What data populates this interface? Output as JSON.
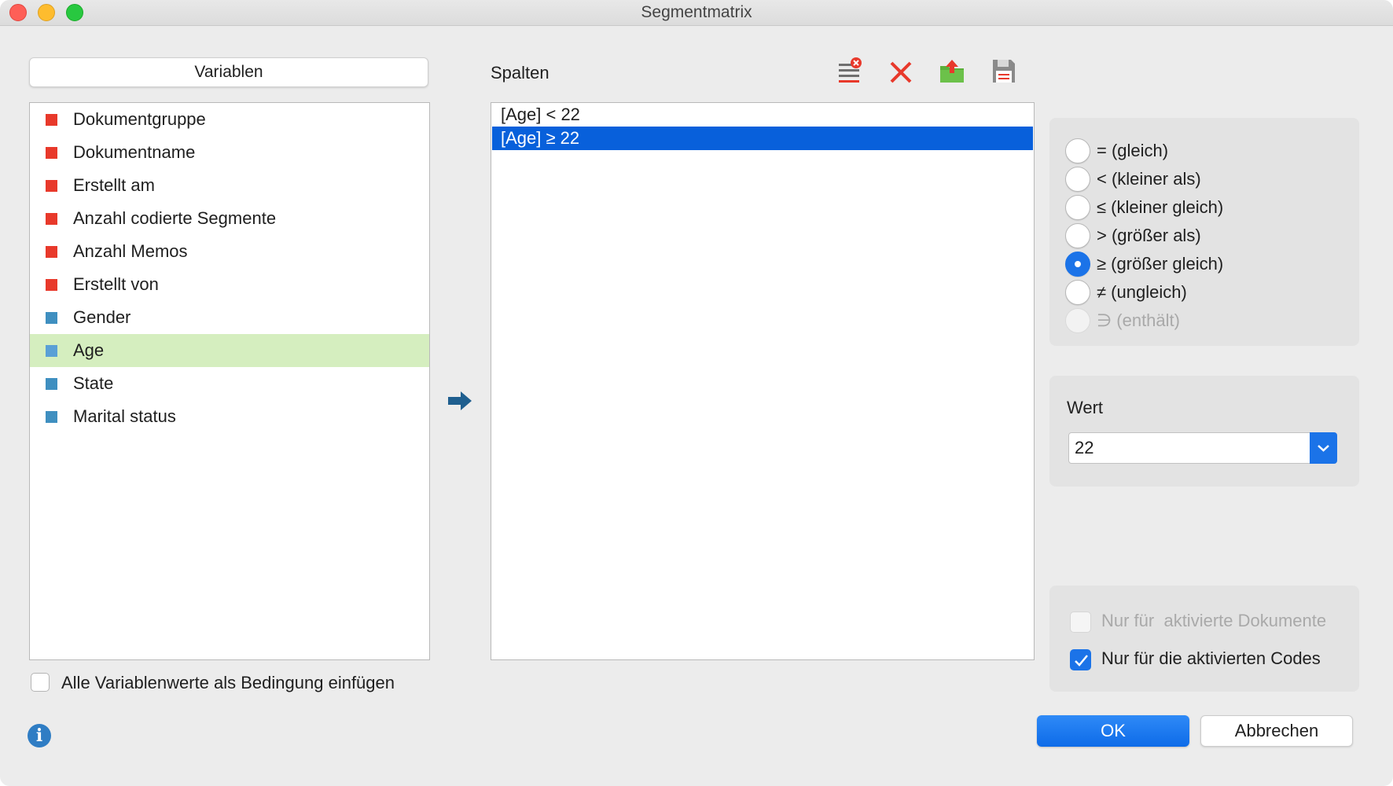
{
  "window": {
    "title": "Segmentmatrix"
  },
  "variables_panel": {
    "header_label": "Variablen",
    "items": [
      {
        "label": "Dokumentgruppe",
        "color": "#e8392b"
      },
      {
        "label": "Dokumentname",
        "color": "#e8392b"
      },
      {
        "label": "Erstellt am",
        "color": "#e8392b"
      },
      {
        "label": "Anzahl codierte Segmente",
        "color": "#e8392b"
      },
      {
        "label": "Anzahl Memos",
        "color": "#e8392b"
      },
      {
        "label": "Erstellt von",
        "color": "#e8392b"
      },
      {
        "label": "Gender",
        "color": "#3f8fc0"
      },
      {
        "label": "Age",
        "color": "#3f8fc0",
        "selected": true
      },
      {
        "label": "State",
        "color": "#3f8fc0"
      },
      {
        "label": "Marital status",
        "color": "#3f8fc0"
      }
    ],
    "insert_all_values_label": "Alle Variablenwerte als Bedingung einfügen",
    "insert_all_values_checked": false
  },
  "columns_panel": {
    "label": "Spalten",
    "toolbar": [
      "clear-list-icon",
      "delete-icon",
      "export-icon",
      "save-icon"
    ],
    "items": [
      {
        "label": "[Age] < 22",
        "selected": false
      },
      {
        "label": "[Age] ≥ 22",
        "selected": true
      }
    ]
  },
  "operators": {
    "options": [
      {
        "label": "= (gleich)",
        "checked": false,
        "disabled": false
      },
      {
        "label": "< (kleiner als)",
        "checked": false,
        "disabled": false
      },
      {
        "label": "≤ (kleiner gleich)",
        "checked": false,
        "disabled": false
      },
      {
        "label": "> (größer als)",
        "checked": false,
        "disabled": false
      },
      {
        "label": "≥ (größer gleich)",
        "checked": true,
        "disabled": false
      },
      {
        "label": "≠ (ungleich)",
        "checked": false,
        "disabled": false
      },
      {
        "label": "∋ (enthält)",
        "checked": false,
        "disabled": true
      }
    ]
  },
  "value_panel": {
    "label": "Wert",
    "value": "22"
  },
  "filters": {
    "only_activated_documents_label": "Nur für  aktivierte Dokumente",
    "only_activated_documents_checked": false,
    "only_activated_documents_disabled": true,
    "only_activated_codes_label": "Nur für die aktivierten Codes",
    "only_activated_codes_checked": true
  },
  "buttons": {
    "ok": "OK",
    "cancel": "Abbrechen"
  },
  "colors": {
    "accent": "#1b73e8",
    "selection_green": "#d5eebf",
    "selection_blue": "#0860db"
  }
}
